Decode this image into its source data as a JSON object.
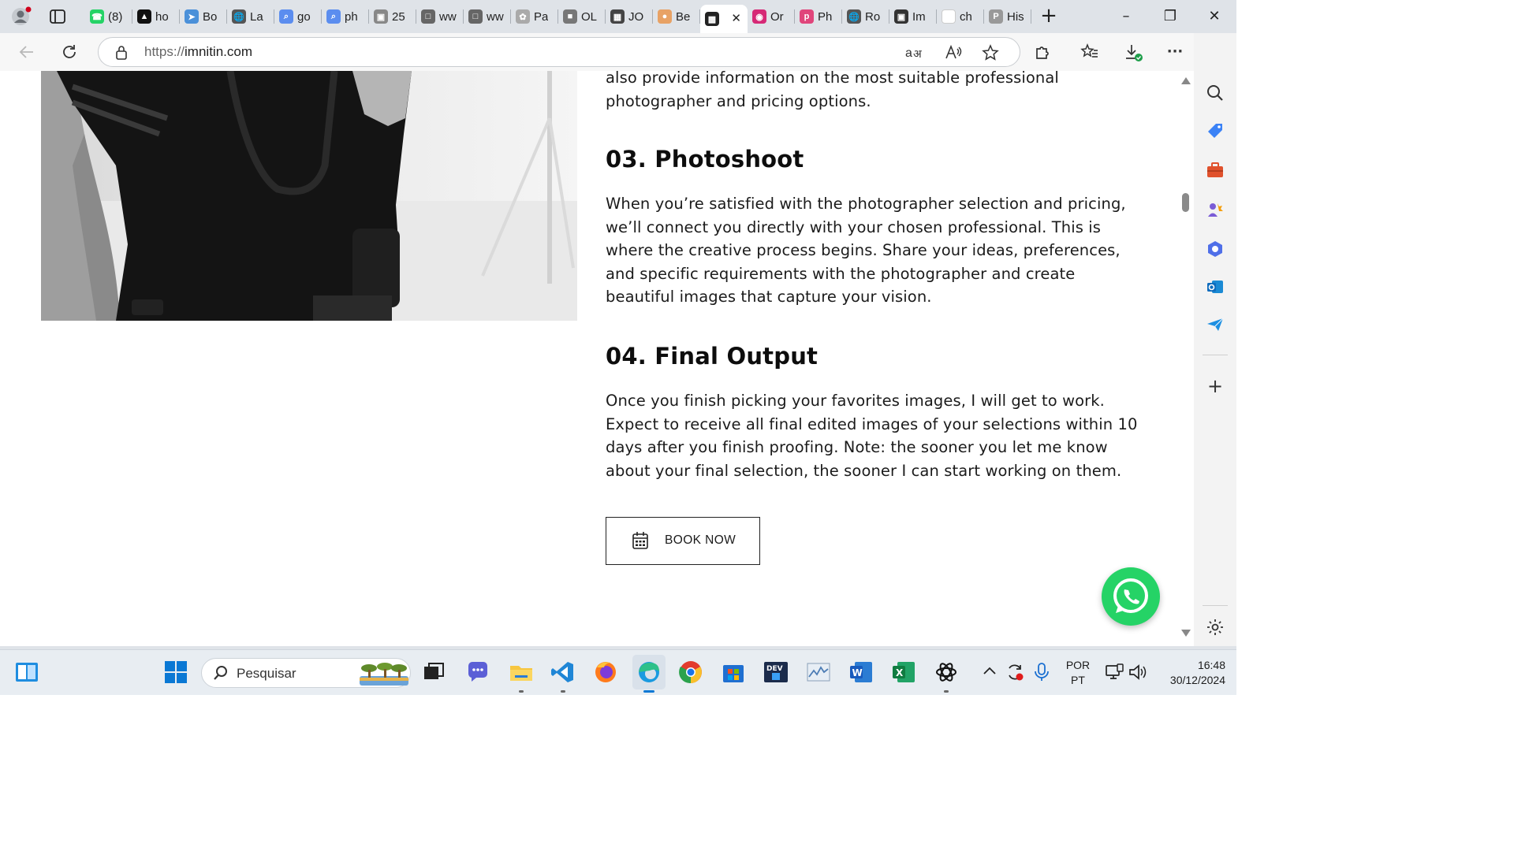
{
  "browser": {
    "tabs": [
      {
        "title": "(8)",
        "icon": "whatsapp-icon",
        "color": "#25d366"
      },
      {
        "title": "ho",
        "icon": "triangle-logo-icon",
        "color": "#111111"
      },
      {
        "title": "Bo",
        "icon": "bird-logo-icon",
        "color": "#4a90d9"
      },
      {
        "title": "La",
        "icon": "globe-icon",
        "color": "#555555"
      },
      {
        "title": "go",
        "icon": "search-icon",
        "color": "#5b8def"
      },
      {
        "title": "ph",
        "icon": "search-icon",
        "color": "#5b8def"
      },
      {
        "title": "25",
        "icon": "image-icon",
        "color": "#888888"
      },
      {
        "title": "ww",
        "icon": "doc-icon",
        "color": "#666666"
      },
      {
        "title": "ww",
        "icon": "doc-icon",
        "color": "#666666"
      },
      {
        "title": "Pa",
        "icon": "leaf-icon",
        "color": "#aaaaaa"
      },
      {
        "title": "OL",
        "icon": "cube-icon",
        "color": "#777777"
      },
      {
        "title": "JO",
        "icon": "grid-logo-icon",
        "color": "#444444"
      },
      {
        "title": "Be",
        "icon": "orange-logo-icon",
        "color": "#e8a265"
      },
      {
        "title": "",
        "icon": "pattern-logo-icon",
        "color": "#222222",
        "active": true
      },
      {
        "title": "Or",
        "icon": "instagram-icon",
        "color": "#d62976"
      },
      {
        "title": "Ph",
        "icon": "p-logo-icon",
        "color": "#e0457b"
      },
      {
        "title": "Ro",
        "icon": "globe-icon",
        "color": "#555555"
      },
      {
        "title": "Im",
        "icon": "camera-icon",
        "color": "#333333"
      },
      {
        "title": "ch",
        "icon": "blank-icon",
        "color": "#ffffff"
      },
      {
        "title": "His",
        "icon": "p-letter-icon",
        "color": "#999999"
      }
    ],
    "address": {
      "scheme": "https://",
      "host": "imnitin.com"
    }
  },
  "page": {
    "intro_tail": "also provide information on the most suitable professional photographer and pricing options.",
    "step3_title": "03. Photoshoot",
    "step3_text": "When you’re satisfied with the photographer selection and pricing, we’ll connect you directly with your chosen professional. This is where the creative process begins. Share your ideas, preferences, and specific requirements with the photographer and create beautiful images that capture your vision.",
    "step4_title": "04. Final Output",
    "step4_text": "Once you finish picking your favorites images, I will get to work. Expect to receive all final edited images of your selections within 10 days after you finish proofing. Note: the sooner you let me know about your final selection, the sooner I can start working on them.",
    "book_label": "BOOK NOW"
  },
  "taskbar": {
    "search_placeholder": "Pesquisar",
    "lang_top": "POR",
    "lang_bottom": "PT",
    "time": "16:48",
    "date": "30/12/2024"
  },
  "colors": {
    "whatsapp": "#25d366",
    "text": "#1b1b1b"
  }
}
